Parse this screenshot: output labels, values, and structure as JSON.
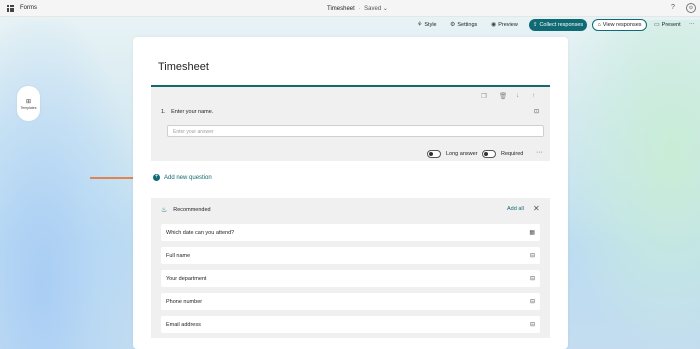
{
  "topbar": {
    "app_name": "Forms",
    "doc_title": "Timesheet",
    "separator": "·",
    "saved_label": "Saved",
    "help": "?",
    "avatar": "⊙"
  },
  "toolbar": {
    "style_label": "Style",
    "settings_label": "Settings",
    "preview_label": "Preview",
    "collect_label": "Collect responses",
    "view_label": "View responses",
    "present_label": "Present",
    "more": "···"
  },
  "side": {
    "templates_label": "Templates"
  },
  "form": {
    "title": "Timesheet",
    "question": {
      "number": "1.",
      "text": "Enter your name.",
      "placeholder": "Enter your answer",
      "long_answer_label": "Long answer",
      "required_label": "Required"
    },
    "add_question_label": "Add new question"
  },
  "recommended": {
    "title": "Recommended",
    "add_all_label": "Add all",
    "items": [
      {
        "label": "Which date can you attend?",
        "icon": "calendar-icon"
      },
      {
        "label": "Full name",
        "icon": "text-field-icon"
      },
      {
        "label": "Your department",
        "icon": "text-field-icon"
      },
      {
        "label": "Phone number",
        "icon": "text-field-icon"
      },
      {
        "label": "Email address",
        "icon": "text-field-icon"
      }
    ]
  },
  "colors": {
    "accent": "#0f6a73",
    "arrow": "#e8671d"
  }
}
